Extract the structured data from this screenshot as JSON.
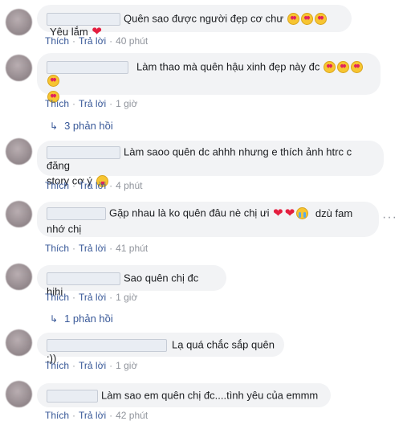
{
  "comments": [
    {
      "text": "Quên sao được người đẹp cơ chư",
      "after_text": "Yêu lắm",
      "action_like": "Thích",
      "action_reply": "Trả lời",
      "time": "40 phút"
    },
    {
      "text": "Làm thao mà quên hậu xinh đẹp này đc",
      "action_like": "Thích",
      "action_reply": "Trả lời",
      "time": "1 giờ",
      "replies": "3 phản hồi"
    },
    {
      "text_line1": "Làm saoo quên dc ahhh nhưng e thích ảnh htrc c đăng",
      "text_line2": "story cơ ý",
      "action_like": "Thích",
      "action_reply": "Trả lời",
      "time": "4 phút"
    },
    {
      "text_line1": "Gặp nhau là ko quên đâu nè chị ưi",
      "text_line1_tail": "dzù fam",
      "text_line2": "nhớ chị",
      "action_like": "Thích",
      "action_reply": "Trả lời",
      "time": "41 phút",
      "more": "···"
    },
    {
      "text": "Sao quên chị đc hihi",
      "action_like": "Thích",
      "action_reply": "Trả lời",
      "time": "1 giờ",
      "replies": "1 phản hồi"
    },
    {
      "text": "Lạ quá chắc sắp quên :))",
      "action_like": "Thích",
      "action_reply": "Trả lời",
      "time": "1 giờ"
    },
    {
      "text": "Làm sao em quên chị đc....tình yêu của emmm",
      "action_like": "Thích",
      "action_reply": "Trả lời",
      "time": "42 phút"
    }
  ],
  "icons": {
    "heart_eyes": "smiling-face-heart-eyes",
    "heart": "red-heart",
    "tongue": "winking-face-tongue",
    "cry": "loudly-crying-face",
    "reply_arrow": "reply-arrow"
  },
  "colors": {
    "link": "#385898",
    "bubble": "#f2f3f5",
    "muted": "#90949c",
    "heart": "#e41e3f"
  }
}
